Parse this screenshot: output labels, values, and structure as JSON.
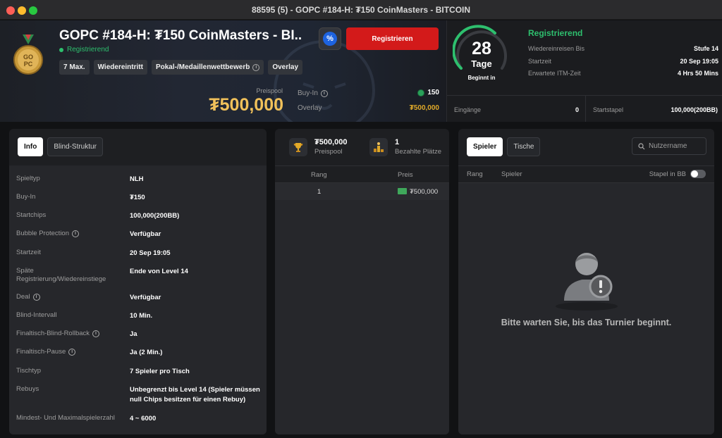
{
  "window": {
    "title": "88595 (5) - GOPC #184-H: ₮150 CoinMasters - BITCOIN"
  },
  "header": {
    "title": "GOPC #184-H: ₮150 CoinMasters - BI...",
    "status": "Registrierend",
    "tags": [
      "7 Max.",
      "Wiedereintritt",
      "Pokal-/Medaillenwettbewerb",
      "Overlay"
    ],
    "register_label": "Registrieren",
    "prizepool_label": "Preispool",
    "prizepool_value": "₮500,000",
    "buyin_label": "Buy-In",
    "buyin_value": "150",
    "overlay_label": "Overlay",
    "overlay_value": "₮500,000",
    "countdown": {
      "number": "28",
      "unit": "Tage",
      "caption": "Beginnt in"
    },
    "reg_status": "Registrierend",
    "details": [
      {
        "k": "Wiedereinreisen Bis",
        "v": "Stufe 14"
      },
      {
        "k": "Startzeit",
        "v": "20 Sep 19:05"
      },
      {
        "k": "Erwartete ITM-Zeit",
        "v": "4 Hrs 50 Mins"
      }
    ],
    "entries_label": "Eingänge",
    "entries_value": "0",
    "stack_label": "Startstapel",
    "stack_value": "100,000(200BB)"
  },
  "info_panel": {
    "tabs": [
      "Info",
      "Blind-Struktur"
    ],
    "rows": [
      {
        "k": "Spieltyp",
        "v": "NLH"
      },
      {
        "k": "Buy-In",
        "v": "₮150"
      },
      {
        "k": "Startchips",
        "v": "100,000(200BB)"
      },
      {
        "k": "Bubble Protection",
        "v": "Verfügbar"
      },
      {
        "k": "Startzeit",
        "v": "20 Sep 19:05"
      },
      {
        "k": "Späte Registrierung/Wiedereinstiege",
        "v": "Ende von Level 14"
      },
      {
        "k": "Deal",
        "v": "Verfügbar"
      },
      {
        "k": "Blind-Intervall",
        "v": "10 Min."
      },
      {
        "k": "Finaltisch-Blind-Rollback",
        "v": "Ja"
      },
      {
        "k": "Finaltisch-Pause",
        "v": "Ja (2 Min.)"
      },
      {
        "k": "Tischtyp",
        "v": "7 Spieler pro Tisch"
      },
      {
        "k": "Rebuys",
        "v": "Unbegrenzt bis Level 14 (Spieler müssen null Chips besitzen für einen Rebuy)"
      },
      {
        "k": "Mindest- Und Maximalspielerzahl",
        "v": "4 ~ 6000"
      }
    ]
  },
  "prize_panel": {
    "prizepool_value": "₮500,000",
    "prizepool_label": "Preispool",
    "paid_value": "1",
    "paid_label": "Bezahlte Plätze",
    "col_rank": "Rang",
    "col_prize": "Preis",
    "rows": [
      {
        "rank": "1",
        "prize": "₮500,000"
      }
    ]
  },
  "players_panel": {
    "tabs": [
      "Spieler",
      "Tische"
    ],
    "search_placeholder": "Nutzername",
    "col_rank": "Rang",
    "col_player": "Spieler",
    "col_stack": "Stapel in BB",
    "empty_message": "Bitte warten Sie, bis das Turnier beginnt."
  },
  "colors": {
    "accent_green": "#2ebf6e",
    "register_red": "#d31a1a",
    "gold": "#f1c15a"
  }
}
